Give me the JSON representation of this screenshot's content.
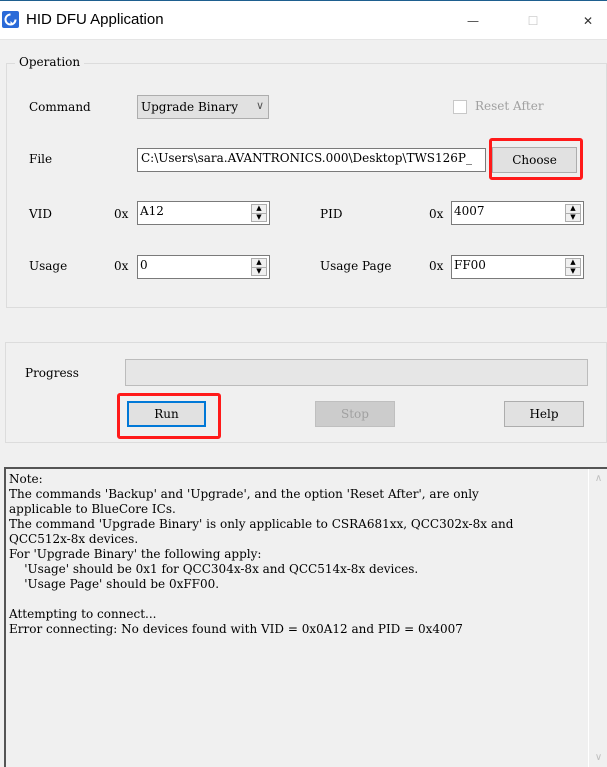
{
  "window": {
    "title": "HID DFU Application",
    "icon": "refresh-circle-icon",
    "controls": {
      "minimize": "—",
      "maximize": "☐",
      "close": "✕"
    }
  },
  "operation": {
    "legend": "Operation",
    "command_label": "Command",
    "command_value": "Upgrade Binary",
    "reset_after_label": "Reset After",
    "reset_after_checked": false,
    "file_label": "File",
    "file_value": "C:\\Users\\sara.AVANTRONICS.000\\Desktop\\TWS126P_",
    "choose_label": "Choose",
    "vid_label": "VID",
    "vid_prefix": "0x",
    "vid_value": "A12",
    "pid_label": "PID",
    "pid_prefix": "0x",
    "pid_value": "4007",
    "usage_label": "Usage",
    "usage_prefix": "0x",
    "usage_value": "0",
    "usage_page_label": "Usage Page",
    "usage_page_prefix": "0x",
    "usage_page_value": "FF00"
  },
  "progress": {
    "label": "Progress",
    "value_percent": 0,
    "run_label": "Run",
    "stop_label": "Stop",
    "help_label": "Help"
  },
  "log": {
    "lines": [
      "Note:",
      "The commands 'Backup' and 'Upgrade', and the option 'Reset After', are only",
      "applicable to BlueCore ICs.",
      "The command 'Upgrade Binary' is only applicable to CSRA681xx, QCC302x-8x and",
      "QCC512x-8x devices.",
      "For 'Upgrade Binary' the following apply:",
      "    'Usage' should be 0x1 for QCC304x-8x and QCC514x-8x devices.",
      "    'Usage Page' should be 0xFF00.",
      "",
      "Attempting to connect...",
      "Error connecting: No devices found with VID = 0x0A12 and PID = 0x4007"
    ]
  },
  "colors": {
    "highlight": "#ff1a1a",
    "focus": "#0078d7",
    "app_icon": "#2a6ad8"
  }
}
